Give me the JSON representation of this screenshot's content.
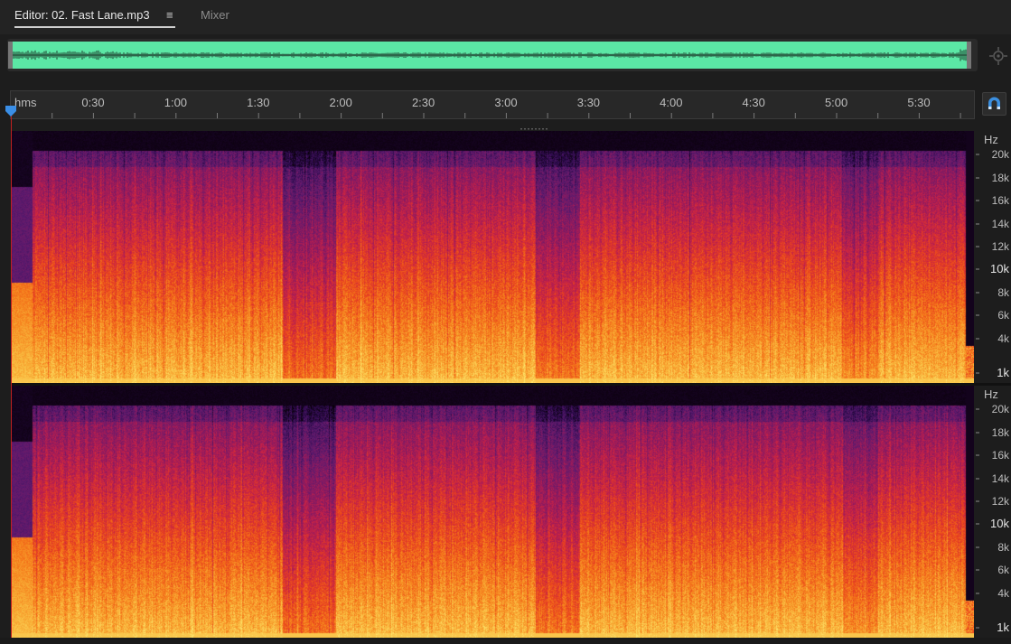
{
  "tabs": {
    "editor_label": "Editor: 02. Fast Lane.mp3",
    "mixer_label": "Mixer",
    "menu_icon": "hamburger-icon"
  },
  "overview": {
    "waveform_color": "#5be7a5",
    "zoom_icon": "zoom-navigator-icon"
  },
  "timeline": {
    "units_label": "hms",
    "time_labels": [
      "0:30",
      "1:00",
      "1:30",
      "2:00",
      "2:30",
      "3:00",
      "3:30",
      "4:00",
      "4:30",
      "5:00",
      "5:30"
    ],
    "snap_icon": "snap-magnet-icon",
    "playhead_color": "#3a8ee6"
  },
  "spectral": {
    "channels": [
      {
        "name": "channel-1"
      },
      {
        "name": "channel-2"
      }
    ],
    "hz_label": "Hz",
    "freq_labels": [
      "20k",
      "18k",
      "16k",
      "14k",
      "12k",
      "10k",
      "8k",
      "6k",
      "4k",
      "1k"
    ],
    "colormap": [
      "#080006",
      "#2a0a4a",
      "#5a1a6e",
      "#8c1a60",
      "#c2204a",
      "#e8401f",
      "#f57a1a",
      "#f9b43a",
      "#fde36a"
    ]
  }
}
